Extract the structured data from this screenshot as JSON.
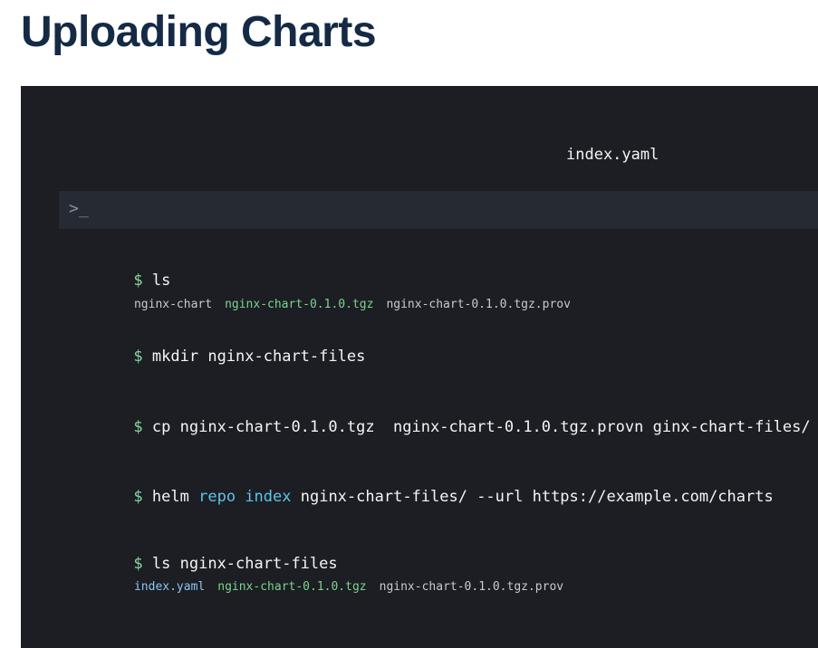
{
  "page": {
    "title": "Uploading Charts"
  },
  "terminal": {
    "floating_filename": "index.yaml",
    "prompt_icon": ">_",
    "commands": [
      {
        "prompt": "$",
        "text": "ls",
        "output": [
          "nginx-chart",
          "nginx-chart-0.1.0.tgz",
          "nginx-chart-0.1.0.tgz.prov"
        ]
      },
      {
        "prompt": "$",
        "text": "mkdir nginx-chart-files"
      },
      {
        "prompt": "$",
        "text": "cp nginx-chart-0.1.0.tgz  nginx-chart-0.1.0.tgz.provn ginx-chart-files/"
      },
      {
        "prompt": "$",
        "text_parts": [
          "helm ",
          "repo",
          " ",
          "index",
          " nginx-chart-files/ --url https://example.com/charts"
        ]
      },
      {
        "prompt": "$",
        "text": "ls nginx-chart-files",
        "output": [
          "index.yaml",
          "nginx-chart-0.1.0.tgz",
          "nginx-chart-0.1.0.tgz.prov"
        ]
      }
    ]
  },
  "colors": {
    "title": "#142a45",
    "terminal_bg": "#1c1e24",
    "prompt_bar_bg": "#262a33",
    "prompt_dollar": "#86d99c",
    "keyword": "#5cc5e8",
    "file_green": "#7ad48c",
    "file_blue": "#8cc6ee",
    "file_plain": "#c6cad0"
  },
  "icons": {
    "prompt_icon": "terminal-prompt-icon"
  }
}
